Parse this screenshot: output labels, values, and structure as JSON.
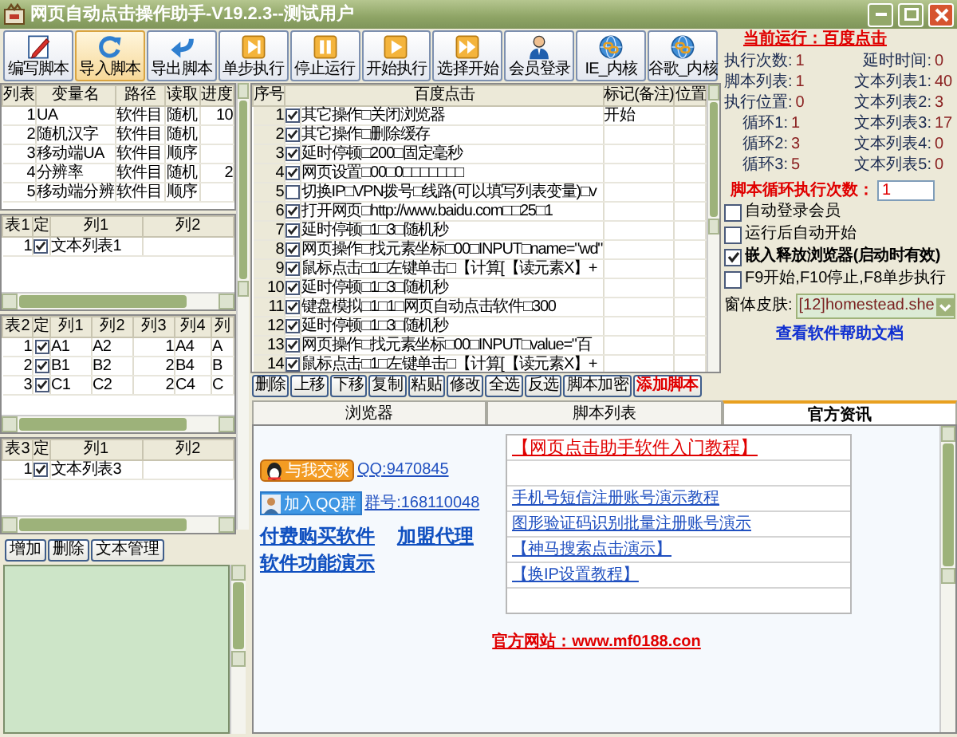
{
  "window": {
    "title": "网页自动点击操作助手-V19.2.3--测试用户"
  },
  "toolbar": [
    {
      "label": "编写脚本",
      "kind": "edit",
      "selected": false
    },
    {
      "label": "导入脚本",
      "kind": "import",
      "selected": true
    },
    {
      "label": "导出脚本",
      "kind": "export",
      "selected": false
    },
    {
      "label": "单步执行",
      "kind": "step",
      "selected": false
    },
    {
      "label": "停止运行",
      "kind": "pause",
      "selected": false
    },
    {
      "label": "开始执行",
      "kind": "play",
      "selected": false
    },
    {
      "label": "选择开始",
      "kind": "forward",
      "selected": false
    },
    {
      "label": "会员登录",
      "kind": "member",
      "selected": false
    },
    {
      "label": "IE_内核",
      "kind": "globe",
      "selected": false
    },
    {
      "label": "谷歌_内核",
      "kind": "globe",
      "selected": false
    }
  ],
  "variables": {
    "columns": [
      "列表",
      "变量名",
      "路径",
      "读取",
      "进度"
    ],
    "rows": [
      {
        "index": "1",
        "name": "UA",
        "path": "软件目",
        "read": "随机",
        "progress": "10"
      },
      {
        "index": "2",
        "name": "随机汉字",
        "path": "软件目",
        "read": "随机"
      },
      {
        "index": "3",
        "name": "移动端UA",
        "path": "软件目",
        "read": "顺序"
      },
      {
        "index": "4",
        "name": "分辨率",
        "path": "软件目",
        "read": "随机",
        "progress": "2"
      },
      {
        "index": "5",
        "name": "移动端分辨",
        "path": "软件目",
        "read": "顺序"
      }
    ]
  },
  "text_tables": [
    {
      "columns": [
        "表1",
        "定",
        "列1",
        "列2"
      ],
      "rows": [
        {
          "index": "1",
          "checked": true,
          "values": [
            "文本列表1"
          ]
        }
      ]
    },
    {
      "columns": [
        "表2",
        "定",
        "列1",
        "列2",
        "列3",
        "列4",
        "列"
      ],
      "rows": [
        {
          "index": "1",
          "checked": true,
          "values": [
            "A1",
            "A2",
            "1",
            "A4",
            "A"
          ]
        },
        {
          "index": "2",
          "checked": true,
          "values": [
            "B1",
            "B2",
            "2",
            "B4",
            "B"
          ]
        },
        {
          "index": "3",
          "checked": true,
          "values": [
            "C1",
            "C2",
            "2",
            "C4",
            "C"
          ]
        }
      ]
    },
    {
      "columns": [
        "表3",
        "定",
        "列1",
        "列2"
      ],
      "rows": [
        {
          "index": "1",
          "checked": true,
          "values": [
            "文本列表3"
          ]
        }
      ]
    }
  ],
  "left_buttons": [
    "增加",
    "删除",
    "文本管理"
  ],
  "script": {
    "columns": [
      "序号",
      "百度点击",
      "标记(备注)",
      "位置"
    ],
    "rows": [
      {
        "index": "1",
        "checked": true,
        "text": "其它操作□关闭浏览器",
        "mark": "开始"
      },
      {
        "index": "2",
        "checked": true,
        "text": "其它操作□删除缓存"
      },
      {
        "index": "3",
        "checked": true,
        "text": "延时停顿□200□固定毫秒"
      },
      {
        "index": "4",
        "checked": true,
        "text": "网页设置□00□0□□□□□□□"
      },
      {
        "index": "5",
        "checked": false,
        "text": "切换IP□VPN拨号□线路(可以填写列表变量)□v"
      },
      {
        "index": "6",
        "checked": true,
        "text": "打开网页□http://www.baidu.com□□25□1"
      },
      {
        "index": "7",
        "checked": true,
        "text": "延时停顿□1□3□随机秒"
      },
      {
        "index": "8",
        "checked": true,
        "text": "网页操作□找元素坐标□00□INPUT□name=\"wd\""
      },
      {
        "index": "9",
        "checked": true,
        "text": "鼠标点击□1□左键单击□【计算[【读元素X】+"
      },
      {
        "index": "10",
        "checked": true,
        "text": "延时停顿□1□3□随机秒"
      },
      {
        "index": "11",
        "checked": true,
        "text": "键盘模拟□1□1□网页自动点击软件□300"
      },
      {
        "index": "12",
        "checked": true,
        "text": "延时停顿□1□3□随机秒"
      },
      {
        "index": "13",
        "checked": true,
        "text": "网页操作□找元素坐标□00□INPUT□value=\"百"
      },
      {
        "index": "14",
        "checked": true,
        "text": "鼠标点击□1□左键单击□【计算[【读元素X】+"
      }
    ]
  },
  "script_buttons": [
    {
      "label": "删除",
      "kind": "normal"
    },
    {
      "label": "上移",
      "kind": "normal"
    },
    {
      "label": "下移",
      "kind": "normal"
    },
    {
      "label": "复制",
      "kind": "normal"
    },
    {
      "label": "粘贴",
      "kind": "normal"
    },
    {
      "label": "修改",
      "kind": "normal"
    },
    {
      "label": "全选",
      "kind": "normal"
    },
    {
      "label": "反选",
      "kind": "normal"
    },
    {
      "label": "脚本加密",
      "kind": "normal"
    },
    {
      "label": "添加脚本",
      "kind": "accent"
    }
  ],
  "status": {
    "current": "当前运行：百度点击",
    "stats": [
      {
        "label": "执行次数:",
        "value": "1"
      },
      {
        "label": "延时时间:",
        "value": "0"
      },
      {
        "label": "脚本列表:",
        "value": "1"
      },
      {
        "label": "文本列表1:",
        "value": "40"
      },
      {
        "label": "执行位置:",
        "value": "0"
      },
      {
        "label": "文本列表2:",
        "value": "3"
      },
      {
        "label": "循环1:",
        "value": "1"
      },
      {
        "label": "文本列表3:",
        "value": "17"
      },
      {
        "label": "循环2:",
        "value": "3"
      },
      {
        "label": "文本列表4:",
        "value": "0"
      },
      {
        "label": "循环3:",
        "value": "5"
      },
      {
        "label": "文本列表5:",
        "value": "0"
      }
    ],
    "loop_label": "脚本循环执行次数：",
    "loop_value": "1",
    "options": [
      {
        "label": "自动登录会员",
        "checked": false,
        "bold": false
      },
      {
        "label": "运行后自动开始",
        "checked": false,
        "bold": false
      },
      {
        "label": "嵌入释放浏览器(启动时有效)",
        "checked": true,
        "bold": true
      },
      {
        "label": "F9开始,F10停止,F8单步执行",
        "checked": false,
        "bold": false
      }
    ],
    "skin_label": "窗体皮肤:",
    "skin_value": "[12]homestead.she",
    "help_link": "查看软件帮助文档"
  },
  "tabs": [
    {
      "label": "浏览器",
      "selected": false
    },
    {
      "label": "脚本列表",
      "selected": false
    },
    {
      "label": "官方资讯",
      "selected": true
    }
  ],
  "news": {
    "chat_button": "与我交谈",
    "qq": "QQ:9470845",
    "group_button": "加入QQ群",
    "group": "群号:168110048",
    "links": [
      "付费购买软件",
      "加盟代理",
      "软件功能演示"
    ],
    "list": [
      {
        "kind": "headline",
        "text": "【网页点击助手软件入门教程】"
      },
      {
        "kind": "empty"
      },
      {
        "kind": "link",
        "text": "手机号短信注册账号演示教程"
      },
      {
        "kind": "link",
        "text": "图形验证码识别批量注册账号演示"
      },
      {
        "kind": "link",
        "text": "【神马搜索点击演示】"
      },
      {
        "kind": "link",
        "text": "【换IP设置教程】"
      },
      {
        "kind": "empty"
      }
    ],
    "site": "官方网站：www.mf0188.con"
  }
}
